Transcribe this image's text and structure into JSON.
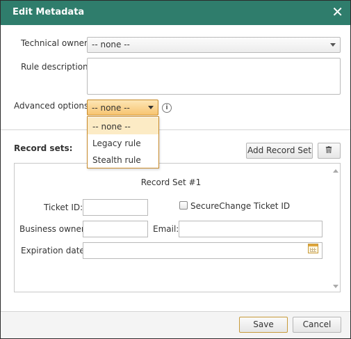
{
  "dialog": {
    "title": "Edit Metadata",
    "close_icon": "close-icon"
  },
  "form": {
    "technical_owner_label": "Technical owner:",
    "technical_owner_value": "-- none --",
    "rule_description_label": "Rule description:",
    "rule_description_value": "",
    "advanced_options_label": "Advanced options:",
    "advanced_options_value": "-- none --"
  },
  "advanced_options_dropdown": {
    "items": [
      {
        "label": "-- none --",
        "selected": true
      },
      {
        "label": "Legacy rule",
        "selected": false
      },
      {
        "label": "Stealth rule",
        "selected": false
      }
    ]
  },
  "record_sets": {
    "label": "Record sets:",
    "add_button": "Add Record Set",
    "delete_icon": "trash-icon",
    "set_title": "Record Set #1",
    "ticket_id_label": "Ticket ID:",
    "ticket_id_value": "",
    "securechange_label": "SecureChange Ticket ID",
    "securechange_checked": false,
    "business_owner_label": "Business owner:",
    "business_owner_value": "",
    "email_label": "Email:",
    "email_value": "",
    "expiration_date_label": "Expiration date:",
    "expiration_date_value": "",
    "calendar_icon": "calendar-icon"
  },
  "footer": {
    "save_label": "Save",
    "cancel_label": "Cancel"
  },
  "colors": {
    "titlebar": "#2f7d6c",
    "accent_orange": "#f7c471",
    "accent_border": "#c78a2a"
  }
}
